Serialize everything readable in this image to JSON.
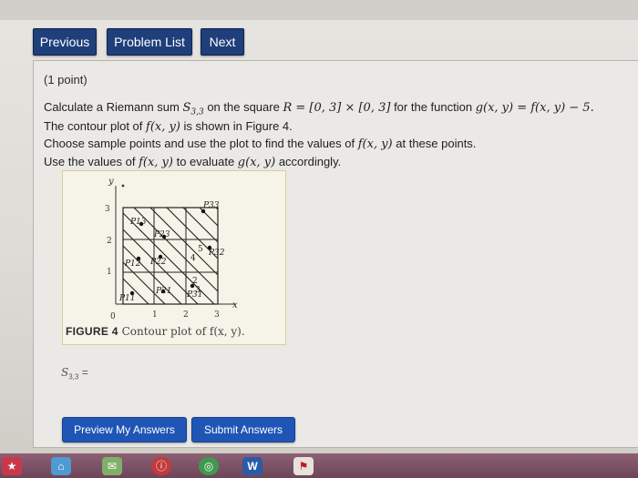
{
  "nav": {
    "previous": "Previous",
    "problem_list": "Problem List",
    "next": "Next"
  },
  "problem": {
    "points": "(1 point)",
    "line1_a": "Calculate a Riemann sum ",
    "line1_sum": "S",
    "line1_sum_sub": "3,3",
    "line1_b": " on the square ",
    "line1_region": "R = [0, 3] × [0, 3]",
    "line1_c": " for the function ",
    "line1_func": "g(x, y) = f(x, y) − 5.",
    "line2_a": "The contour plot of ",
    "line2_f": "f(x, y)",
    "line2_b": " is shown in Figure 4.",
    "line3_a": "Choose sample points and use the plot to find the values of ",
    "line3_f": "f(x, y)",
    "line3_b": " at these points.",
    "line4_a": "Use the values of ",
    "line4_f": "f(x, y)",
    "line4_b": " to evaluate ",
    "line4_g": "g(x, y)",
    "line4_c": " accordingly."
  },
  "figure": {
    "axis_y": "y",
    "axis_x": "x",
    "origin": "0",
    "x_ticks": [
      "1",
      "2",
      "3"
    ],
    "y_ticks": [
      "1",
      "2",
      "3"
    ],
    "contour_labels": [
      "2",
      "3",
      "4",
      "5"
    ],
    "points": {
      "p11": "P11",
      "p12": "P12",
      "p13": "P13",
      "p21": "P21",
      "p22": "P22",
      "p23": "P23",
      "p31": "P31",
      "p32": "P32",
      "p33": "P33"
    },
    "caption_label": "FIGURE 4",
    "caption_text": " Contour plot of f(x, y)."
  },
  "answer": {
    "label": "S",
    "label_sub": "3,3",
    "value": ""
  },
  "actions": {
    "preview": "Preview My Answers",
    "submit": "Submit Answers"
  },
  "taskbar": {
    "word_icon": "W",
    "colors": {
      "brand": "#1f3f7a",
      "submit": "#1f56b6"
    }
  }
}
